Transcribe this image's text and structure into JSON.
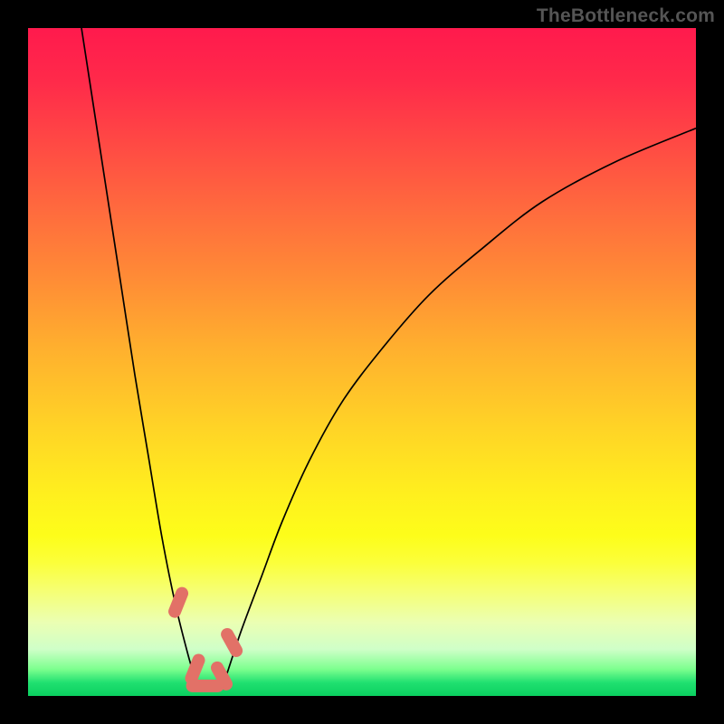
{
  "watermark": "TheBottleneck.com",
  "chart_data": {
    "type": "line",
    "title": "",
    "xlabel": "",
    "ylabel": "",
    "xlim": [
      0,
      100
    ],
    "ylim": [
      0,
      100
    ],
    "legend": false,
    "grid": false,
    "series": [
      {
        "name": "curve-left",
        "x": [
          8,
          10,
          12,
          14,
          16,
          18,
          20,
          22,
          24,
          25.5
        ],
        "y": [
          100,
          87,
          74,
          61,
          48,
          36,
          24,
          14,
          6,
          1
        ]
      },
      {
        "name": "curve-right",
        "x": [
          29,
          30,
          32,
          35,
          38,
          42,
          47,
          53,
          60,
          68,
          77,
          88,
          100
        ],
        "y": [
          1,
          4,
          10,
          18,
          26,
          35,
          44,
          52,
          60,
          67,
          74,
          80,
          85
        ]
      }
    ],
    "markers": [
      {
        "name": "left-upper",
        "x": 22.5,
        "y": 14
      },
      {
        "name": "left-lower",
        "x": 25.0,
        "y": 4
      },
      {
        "name": "right-upper",
        "x": 30.5,
        "y": 8
      },
      {
        "name": "right-lower",
        "x": 29.0,
        "y": 3
      },
      {
        "name": "base",
        "x": 26.5,
        "y": 1.5
      }
    ],
    "background_gradient": {
      "top": "#ff1a4d",
      "middle": "#ffd426",
      "bottom": "#0bd060"
    }
  }
}
